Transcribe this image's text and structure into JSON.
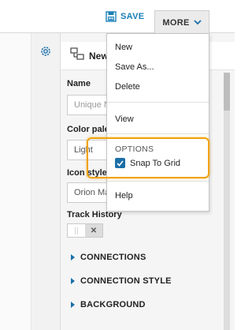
{
  "toolbar": {
    "save_label": "SAVE",
    "more_label": "MORE"
  },
  "panel": {
    "title": "New",
    "name_label": "Name",
    "name_placeholder": "Unique N",
    "color_palette_label": "Color pale",
    "color_palette_value": "Light",
    "icon_style_label": "Icon style",
    "icon_style_value": "Orion Ma",
    "track_history_label": "Track History",
    "toggle_state": "off",
    "sections": [
      "CONNECTIONS",
      "CONNECTION STYLE",
      "BACKGROUND"
    ]
  },
  "menu": {
    "items": [
      "New",
      "Save As...",
      "Delete",
      "View",
      "Help"
    ],
    "options_heading": "OPTIONS",
    "snap_to_grid": {
      "label": "Snap To Grid",
      "checked": true
    }
  },
  "colors": {
    "accent": "#1b6fa8",
    "save_text": "#1b7fb8",
    "highlight": "#f0a20a"
  },
  "icons": [
    "save-icon",
    "chevron-down-icon",
    "gear-icon",
    "diagram-icon",
    "checkmark-icon",
    "caret-right-icon"
  ]
}
